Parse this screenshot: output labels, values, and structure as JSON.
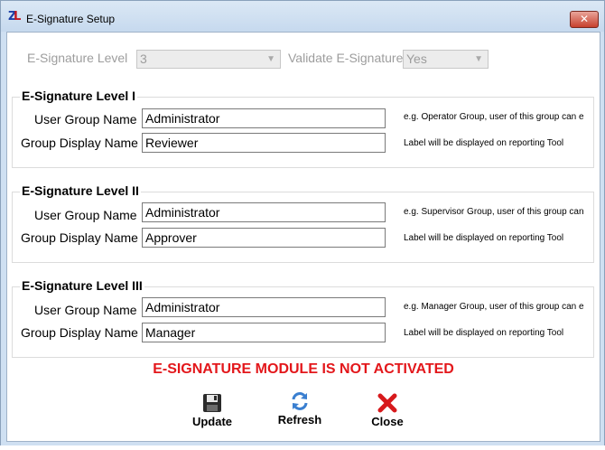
{
  "window": {
    "title": "E-Signature Setup",
    "app_icon": "zl-app-icon",
    "close_glyph": "✕"
  },
  "top": {
    "level_label": "E-Signature Level",
    "level_value": "3",
    "validate_label": "Validate E-Signature",
    "validate_value": "Yes"
  },
  "groups": [
    {
      "title": "E-Signature Level I",
      "user_group_label": "User Group Name",
      "user_group_value": "Administrator",
      "user_group_hint": "e.g. Operator Group, user of this group can e",
      "display_label": "Group Display Name",
      "display_value": "Reviewer",
      "display_hint": "Label will be displayed on reporting Tool"
    },
    {
      "title": "E-Signature Level II",
      "user_group_label": "User Group Name",
      "user_group_value": "Administrator",
      "user_group_hint": "e.g. Supervisor Group, user of this group can",
      "display_label": "Group Display Name",
      "display_value": "Approver",
      "display_hint": "Label will be displayed on reporting Tool"
    },
    {
      "title": "E-Signature Level III",
      "user_group_label": "User Group Name",
      "user_group_value": "Administrator",
      "user_group_hint": "e.g. Manager Group, user of this group can e",
      "display_label": "Group Display Name",
      "display_value": "Manager",
      "display_hint": "Label will be displayed on reporting Tool"
    }
  ],
  "warning": "E-SIGNATURE MODULE IS NOT ACTIVATED",
  "buttons": {
    "update": "Update",
    "refresh": "Refresh",
    "close": "Close"
  },
  "colors": {
    "warning": "#e3171b",
    "refresh_icon": "#3a7fd0",
    "close_icon": "#d7191c"
  }
}
